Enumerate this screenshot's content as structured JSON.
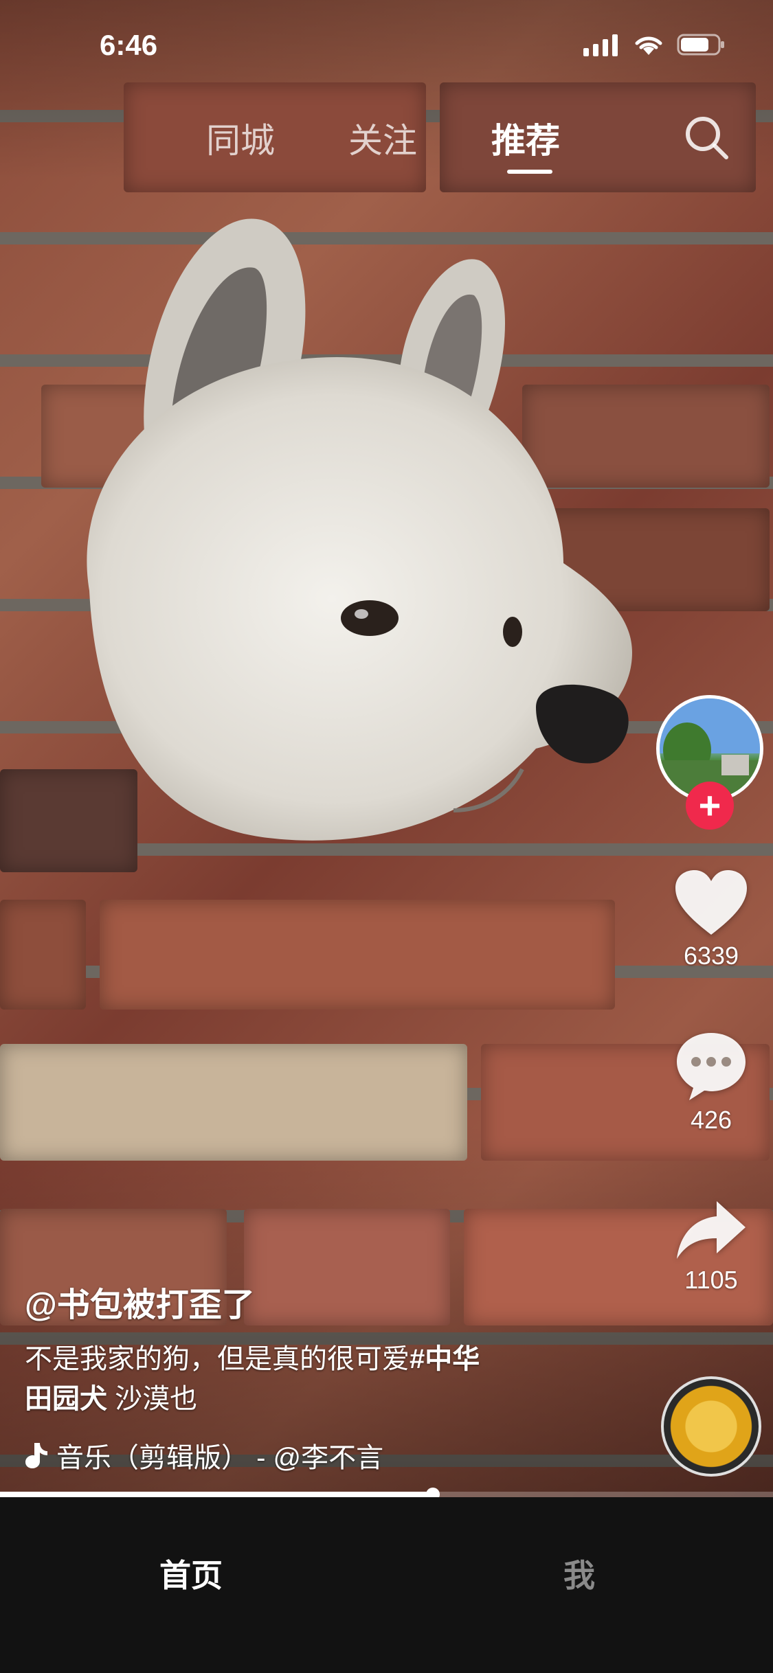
{
  "status_bar": {
    "time": "6:46"
  },
  "top_tabs": [
    {
      "label": "同城",
      "active": false
    },
    {
      "label": "关注",
      "active": false
    },
    {
      "label": "推荐",
      "active": true
    }
  ],
  "icons": {
    "search": "search-icon",
    "like": "heart-icon",
    "comment": "comment-icon",
    "share": "share-icon",
    "music": "music-note-icon",
    "follow": "plus-icon"
  },
  "actions": {
    "likes": "6339",
    "comments": "426",
    "shares": "1105"
  },
  "follow_label": "+",
  "caption": {
    "author": "@书包被打歪了",
    "text_part1": "不是我家的狗，但是真的很可爱",
    "hashtag_line1": "#中华",
    "hashtag_line2": "田园犬",
    "text_part2": " 沙漠也",
    "music": "音乐（剪辑版） - @李不言"
  },
  "progress": {
    "fraction": 0.56
  },
  "bottom_nav": [
    {
      "label": "首页",
      "active": true
    },
    {
      "label": "我",
      "active": false
    }
  ],
  "colors": {
    "follow_red": "#f0294c",
    "nav_bg": "#121212"
  }
}
